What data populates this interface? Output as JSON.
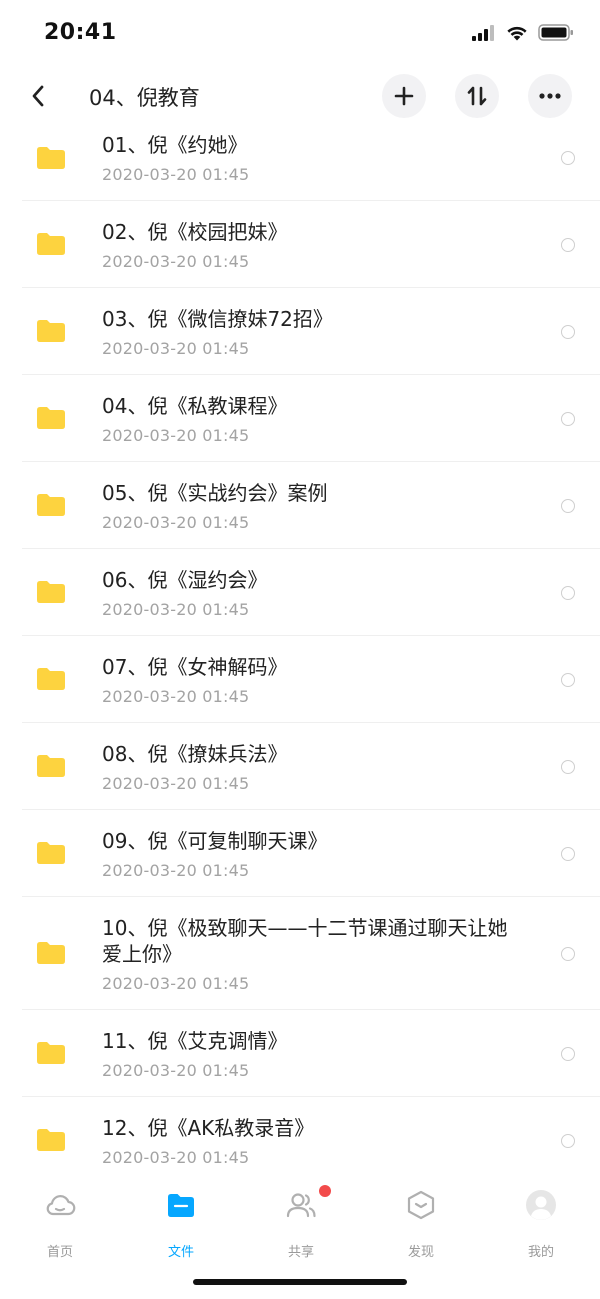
{
  "status_bar": {
    "time": "20:41"
  },
  "nav": {
    "title": "04、倪教育"
  },
  "files": [
    {
      "name": "01、倪《约她》",
      "date": "2020-03-20 01:45"
    },
    {
      "name": "02、倪《校园把妹》",
      "date": "2020-03-20 01:45"
    },
    {
      "name": "03、倪《微信撩妹72招》",
      "date": "2020-03-20 01:45"
    },
    {
      "name": "04、倪《私教课程》",
      "date": "2020-03-20 01:45"
    },
    {
      "name": "05、倪《实战约会》案例",
      "date": "2020-03-20 01:45"
    },
    {
      "name": "06、倪《湿约会》",
      "date": "2020-03-20 01:45"
    },
    {
      "name": "07、倪《女神解码》",
      "date": "2020-03-20 01:45"
    },
    {
      "name": "08、倪《撩妹兵法》",
      "date": "2020-03-20 01:45"
    },
    {
      "name": "09、倪《可复制聊天课》",
      "date": "2020-03-20 01:45"
    },
    {
      "name": "10、倪《极致聊天——十二节课通过聊天让她爱上你》",
      "date": "2020-03-20 01:45"
    },
    {
      "name": "11、倪《艾克调情》",
      "date": "2020-03-20 01:45"
    },
    {
      "name": "12、倪《AK私教录音》",
      "date": "2020-03-20 01:45"
    }
  ],
  "tabs": [
    {
      "label": "首页",
      "icon": "cloud-icon"
    },
    {
      "label": "文件",
      "icon": "folder-icon"
    },
    {
      "label": "共享",
      "icon": "share-people-icon"
    },
    {
      "label": "发现",
      "icon": "discover-icon"
    },
    {
      "label": "我的",
      "icon": "avatar-icon"
    }
  ],
  "colors": {
    "accent": "#06a7ff",
    "folder": "#fdd33f",
    "badge": "#f24b4b",
    "date_text": "#a3a3a3"
  }
}
